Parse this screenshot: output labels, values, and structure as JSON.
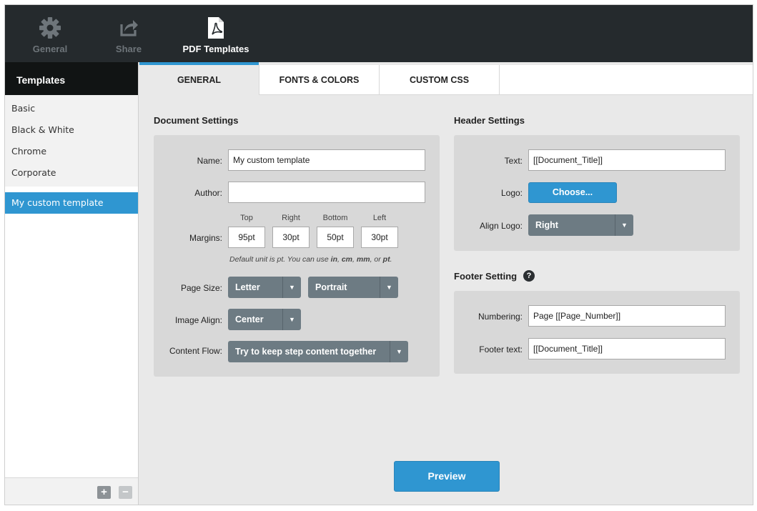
{
  "toolbar": {
    "items": [
      {
        "label": "General",
        "icon": "gear-icon"
      },
      {
        "label": "Share",
        "icon": "share-icon"
      },
      {
        "label": "PDF Templates",
        "icon": "pdf-file-icon"
      }
    ]
  },
  "sidebar": {
    "title": "Templates",
    "templates": [
      "Basic",
      "Black & White",
      "Chrome",
      "Corporate"
    ],
    "custom_templates": [
      "My custom template"
    ],
    "add_label": "+",
    "remove_label": "−"
  },
  "tabs": [
    "GENERAL",
    "FONTS & COLORS",
    "CUSTOM CSS"
  ],
  "document_settings": {
    "title": "Document Settings",
    "name_label": "Name:",
    "name_value": "My custom template",
    "author_label": "Author:",
    "author_value": "",
    "margins_label": "Margins:",
    "margin_top_label": "Top",
    "margin_right_label": "Right",
    "margin_bottom_label": "Bottom",
    "margin_left_label": "Left",
    "margin_top": "95pt",
    "margin_right": "30pt",
    "margin_bottom": "50pt",
    "margin_left": "30pt",
    "hint_prefix": "Default unit is pt. You can use ",
    "hint_in": "in",
    "hint_sep1": ", ",
    "hint_cm": "cm",
    "hint_sep2": ", ",
    "hint_mm": "mm",
    "hint_or": ", or ",
    "hint_pt": "pt",
    "hint_end": ".",
    "page_size_label": "Page Size:",
    "page_size": "Letter",
    "orientation": "Portrait",
    "image_align_label": "Image Align:",
    "image_align": "Center",
    "content_flow_label": "Content Flow:",
    "content_flow": "Try to keep step content together"
  },
  "header_settings": {
    "title": "Header Settings",
    "text_label": "Text:",
    "text_value": "[[Document_Title]]",
    "logo_label": "Logo:",
    "choose_label": "Choose...",
    "align_logo_label": "Align Logo:",
    "align_logo": "Right"
  },
  "footer_settings": {
    "title": "Footer Setting",
    "help_label": "?",
    "numbering_label": "Numbering:",
    "numbering_value": "Page [[Page_Number]]",
    "footer_text_label": "Footer text:",
    "footer_text_value": "[[Document_Title]]"
  },
  "preview_label": "Preview",
  "colors": {
    "accent": "#2f96d1",
    "toolbar_bg": "#252a2d",
    "select_bg": "#6d7b83"
  }
}
